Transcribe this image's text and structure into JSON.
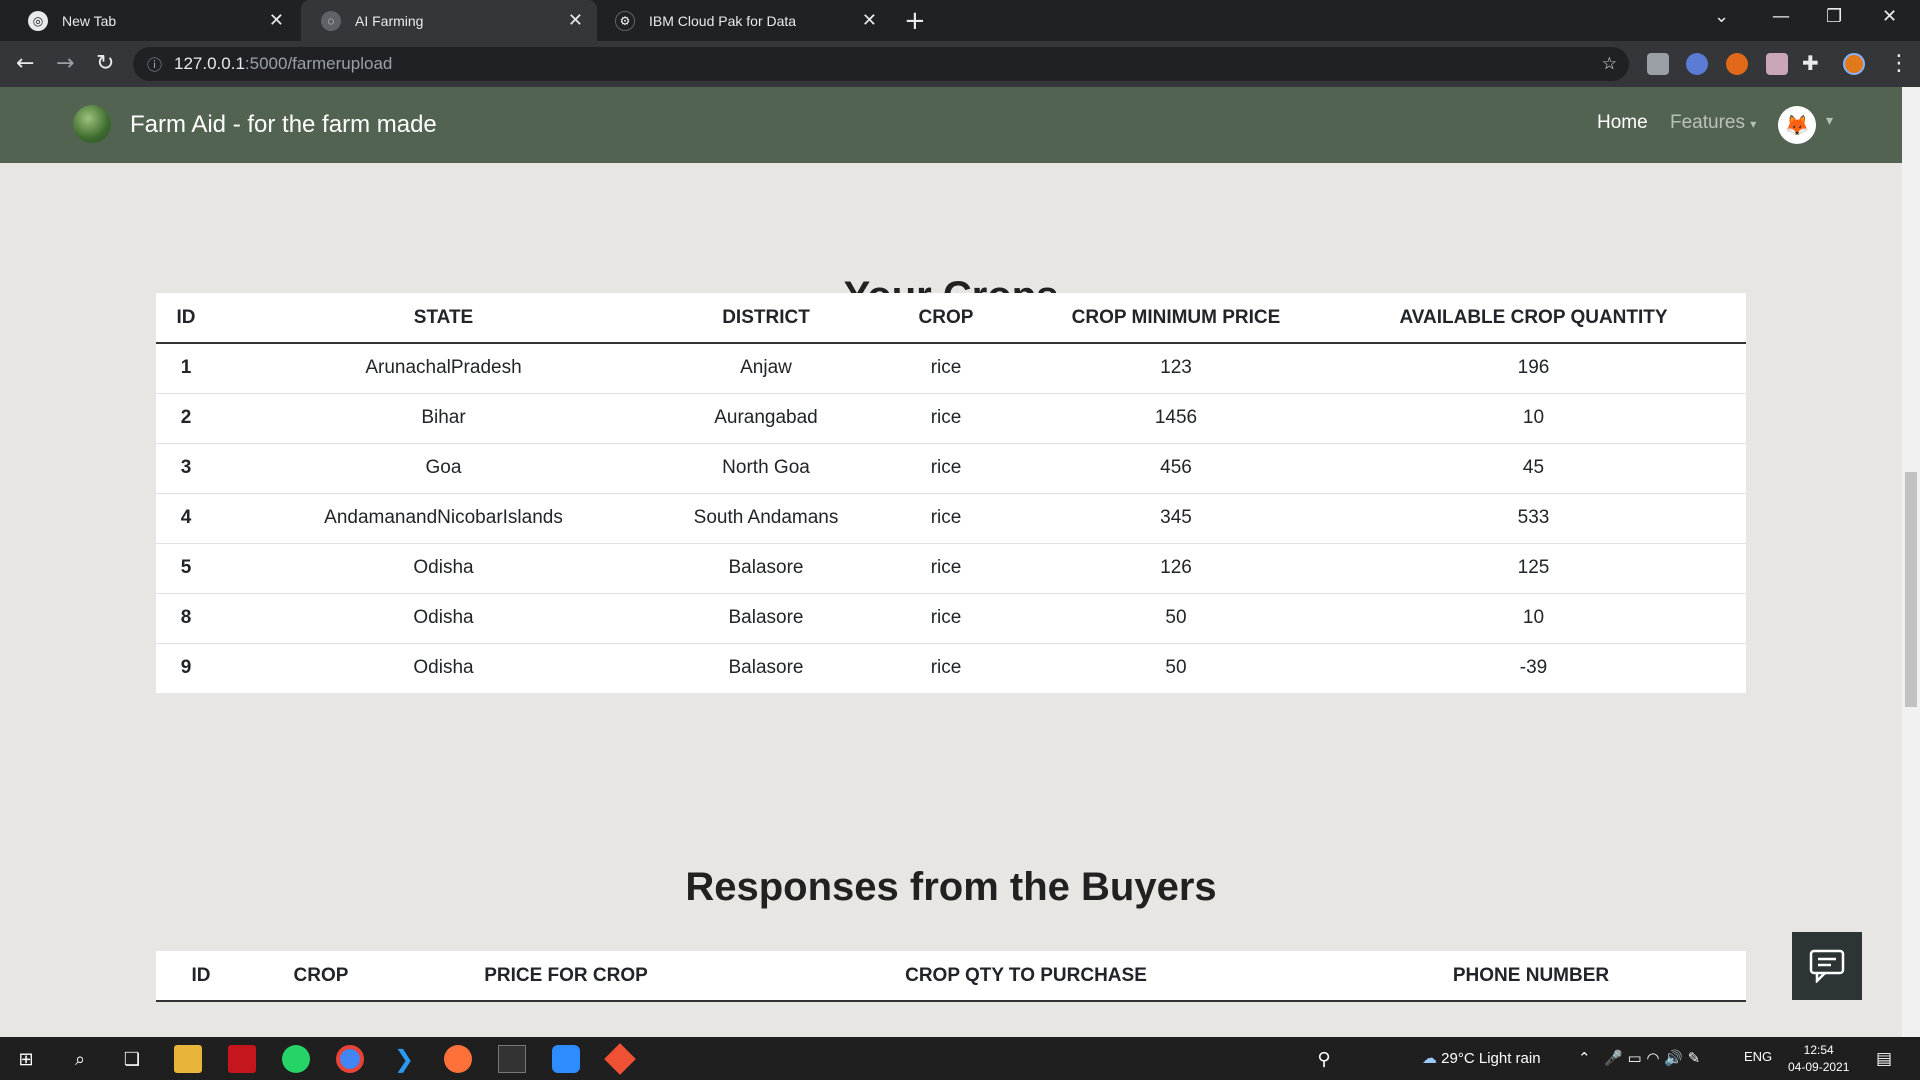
{
  "browser": {
    "tabs": [
      {
        "label": "New Tab",
        "active": false
      },
      {
        "label": "AI Farming",
        "active": true
      },
      {
        "label": "IBM Cloud Pak for Data",
        "active": false
      }
    ],
    "url_host": "127.0.0.1",
    "url_path": ":5000/farmerupload"
  },
  "navbar": {
    "brand": "Farm Aid - for the farm made",
    "home": "Home",
    "features": "Features"
  },
  "crops_section": {
    "title": "Your Crops",
    "headers": [
      "ID",
      "STATE",
      "DISTRICT",
      "CROP",
      "CROP MINIMUM PRICE",
      "AVAILABLE CROP QUANTITY"
    ],
    "rows": [
      [
        "1",
        "ArunachalPradesh",
        "Anjaw",
        "rice",
        "123",
        "196"
      ],
      [
        "2",
        "Bihar",
        "Aurangabad",
        "rice",
        "1456",
        "10"
      ],
      [
        "3",
        "Goa",
        "North Goa",
        "rice",
        "456",
        "45"
      ],
      [
        "4",
        "AndamanandNicobarIslands",
        "South Andamans",
        "rice",
        "345",
        "533"
      ],
      [
        "5",
        "Odisha",
        "Balasore",
        "rice",
        "126",
        "125"
      ],
      [
        "8",
        "Odisha",
        "Balasore",
        "rice",
        "50",
        "10"
      ],
      [
        "9",
        "Odisha",
        "Balasore",
        "rice",
        "50",
        "-39"
      ]
    ]
  },
  "buyers_section": {
    "title": "Responses from the Buyers",
    "headers": [
      "ID",
      "CROP",
      "PRICE FOR CROP",
      "CROP QTY TO PURCHASE",
      "PHONE NUMBER"
    ]
  },
  "taskbar": {
    "weather": "29°C  Light rain",
    "lang": "ENG",
    "time": "12:54",
    "date": "04-09-2021"
  }
}
